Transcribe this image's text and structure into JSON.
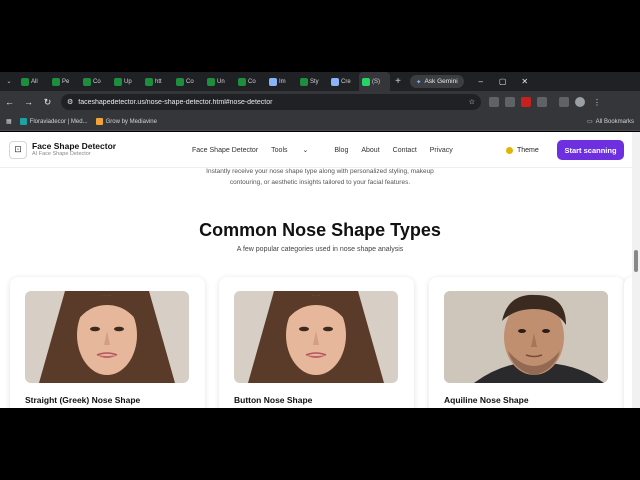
{
  "browser": {
    "tabs": [
      {
        "label": "All",
        "color": "#1e8e3e"
      },
      {
        "label": "Pe",
        "color": "#1e8e3e"
      },
      {
        "label": "Co",
        "color": "#1e8e3e"
      },
      {
        "label": "Up",
        "color": "#1e8e3e"
      },
      {
        "label": "htt",
        "color": "#1e8e3e"
      },
      {
        "label": "Co",
        "color": "#1e8e3e"
      },
      {
        "label": "Un",
        "color": "#1e8e3e"
      },
      {
        "label": "Co",
        "color": "#1e8e3e"
      },
      {
        "label": "Im",
        "color": "#8ab4f8"
      },
      {
        "label": "Sty",
        "color": "#1e8e3e"
      },
      {
        "label": "Cre",
        "color": "#8ab4f8"
      },
      {
        "label": "(S)",
        "color": "#25d366"
      }
    ],
    "ask_gemini": "Ask Gemini",
    "url": "faceshapedetector.us/nose-shape-detector.html#nose-detector",
    "bookmarks": [
      {
        "label": "Floraviadecor | Med...",
        "color": "#1aa3a3"
      },
      {
        "label": "Grow by Mediavine",
        "color": "#f4a236"
      }
    ],
    "all_bookmarks": "All Bookmarks"
  },
  "site": {
    "brand_name": "Face Shape Detector",
    "brand_tagline": "AI Face Shape Detector",
    "nav": [
      "Face Shape Detector",
      "Tools",
      "Blog",
      "About",
      "Contact",
      "Privacy"
    ],
    "theme_label": "Theme",
    "start_label": "Start scanning",
    "accent": "#6d2fe0"
  },
  "main": {
    "intro_line1": "Instantly receive your nose shape type along with personalized styling, makeup",
    "intro_line2": "contouring, or aesthetic insights tailored to your facial features.",
    "section_title": "Common Nose Shape Types",
    "section_subtitle": "A few popular categories used in nose shape analysis",
    "cards": [
      {
        "title": "Straight (Greek) Nose Shape",
        "subject": "woman"
      },
      {
        "title": "Button Nose Shape",
        "subject": "woman"
      },
      {
        "title": "Aquiline Nose Shape",
        "subject": "man"
      }
    ]
  }
}
